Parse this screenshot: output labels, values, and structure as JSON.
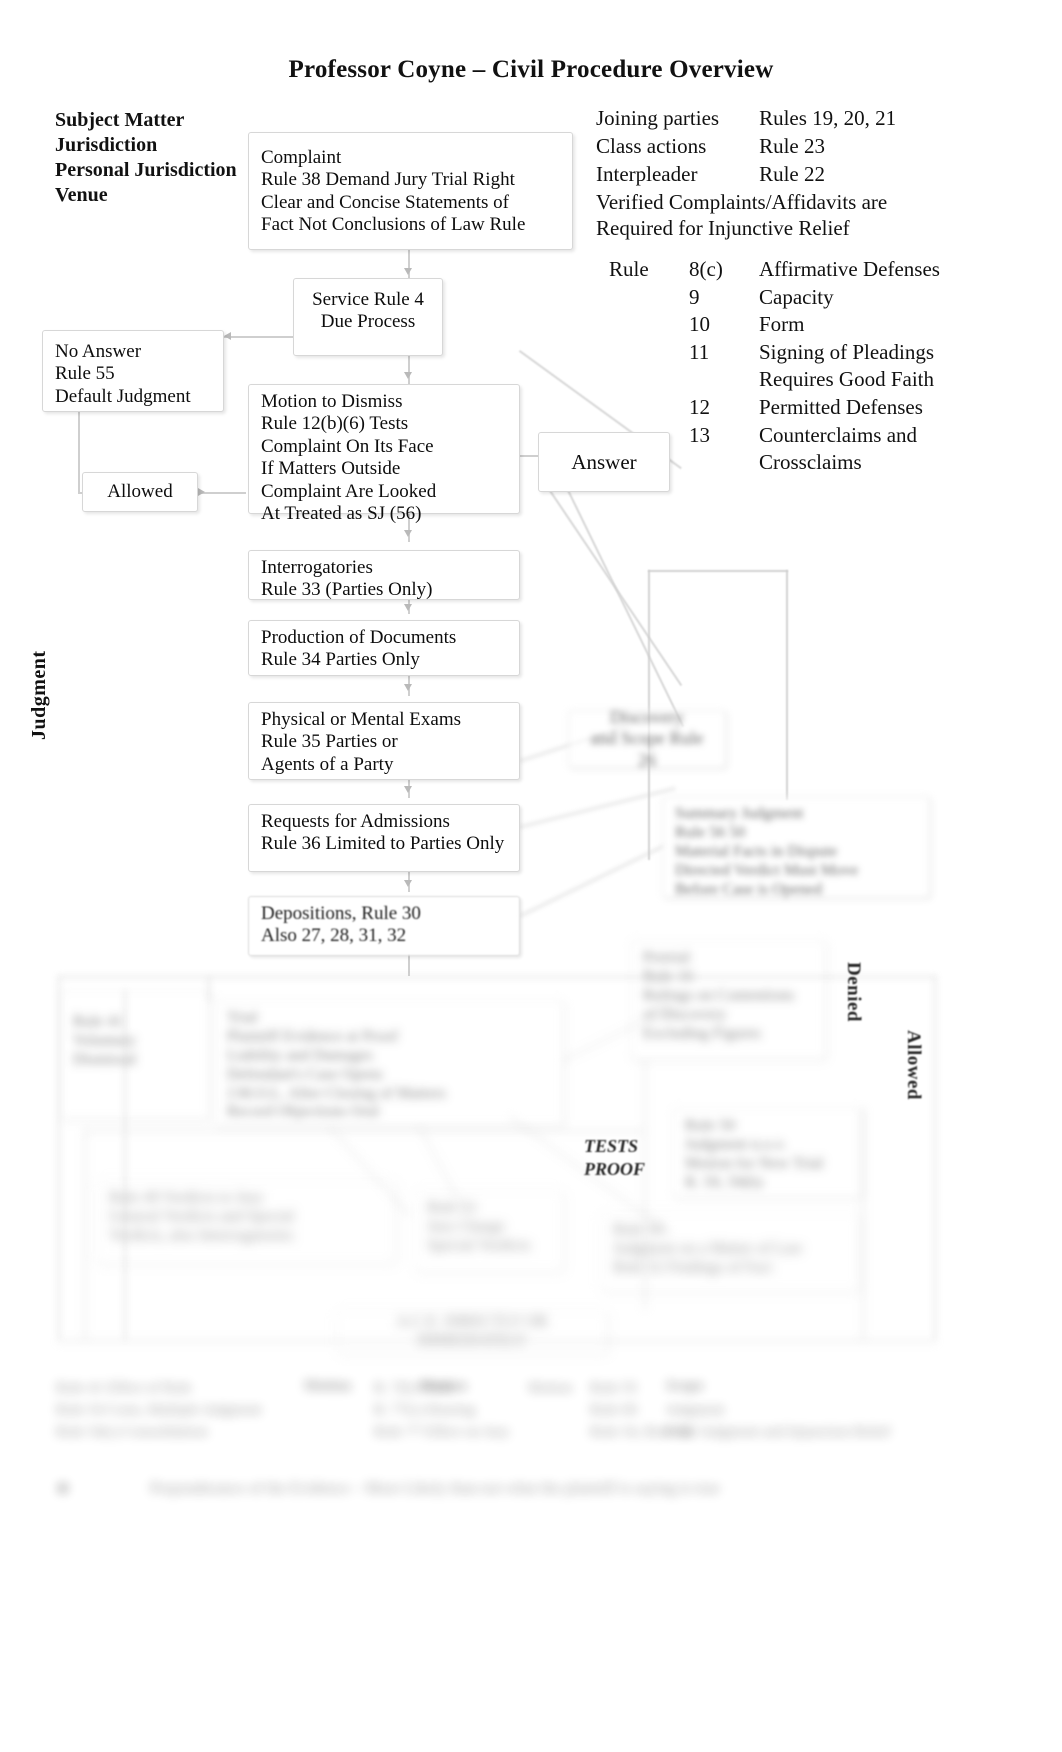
{
  "title": "Professor Coyne – Civil Procedure Overview",
  "left_header": "Subject Matter\nJurisdiction\nPersonal Jurisdiction\nVenue",
  "top_right_pairs": [
    {
      "left": "Joining parties",
      "right": "Rules 19, 20, 21"
    },
    {
      "left": "Class actions",
      "right": "Rule 23"
    },
    {
      "left": "Interpleader",
      "right": "Rule 22"
    }
  ],
  "top_right_note": "Verified Complaints/Affidavits are\nRequired for Injunctive Relief",
  "rules_label": "Rule",
  "rules": [
    {
      "num": "8(c)",
      "desc": "Affirmative Defenses"
    },
    {
      "num": "9",
      "desc": "Capacity"
    },
    {
      "num": "10",
      "desc": "Form"
    },
    {
      "num": "11",
      "desc": "Signing of Pleadings"
    },
    {
      "num": "",
      "desc": "Requires Good Faith"
    },
    {
      "num": "12",
      "desc": "Permitted Defenses"
    },
    {
      "num": "13",
      "desc": "Counterclaims and"
    },
    {
      "num": "",
      "desc": "Crossclaims"
    }
  ],
  "nodes": {
    "complaint": "Complaint\nRule 38 Demand Jury Trial Right\nClear and Concise Statements of\nFact Not Conclusions of Law Rule",
    "service": "Service Rule 4\nDue Process",
    "no_answer": "No Answer\nRule 55\nDefault Judgment",
    "allowed_box": "Allowed",
    "motion_to_dismiss": "Motion to Dismiss\nRule 12(b)(6) Tests\nComplaint On Its Face\nIf Matters Outside\nComplaint Are Looked\nAt Treated as SJ (56)",
    "answer": "Answer",
    "interrogatories": "Interrogatories\nRule 33 (Parties Only)",
    "production": "Production of Documents\nRule 34 Parties Only",
    "exams": "Physical or Mental Exams\nRule 35 Parties or\nAgents of a Party",
    "admissions": "Requests for Admissions\nRule 36 Limited to Parties Only",
    "depositions": "Depositions, Rule 30\nAlso 27, 28, 31, 32",
    "discovery": "Discovery\nand Scope Rule 26",
    "summary_judgment": "Summary Judgment\nRule 56   50\nMaterial Facts in Dispute\nDirected Verdict Must Move\nBefore Case is Opened",
    "denied_chain": "Pretrial\nRule 16\nRulings on Contentions\nof Discovery\nExcluding Figures",
    "jnov": "Rule 50\nJudgment n.o.v.\nMotion for New Trial\nR. 59, 59(b)",
    "trial": "Trial\nPlaintiff Evidence at Proof\nLiability and Damages\nDefendant's Case Opens\nJ.M.O.L. After Closing of Matters\nRecord Objections Oral",
    "rule49": "Rule 49   Verdicts to Jury\nGeneral Verdicts and Special\nVerdicts, also Interrogatories",
    "rule51": "Rule 51\nJury Charge\nSpecial Verdicts",
    "rule58": "Rule 58\nJudgment on a Matter of Law\nRule 52 Findings of Fact",
    "appeal": "Rule 59   Appeal\nRule 60   Relief from Judgment\nRule 62   Stay",
    "final": "A.C.E. DIRECTLY OR IMMEDIATELY",
    "tests_proof": "TESTS\nPROOF",
    "left_small": "Rule 41\nVoluntary\nDismissal",
    "right_small": "Summary Judgment\nRule 56   50\nMaterial Facts in Dispute\nDirected Verdict Must Move\nBefore Case is Opened"
  },
  "vertical_labels": {
    "judgment": "Judgment",
    "denied": "Denied",
    "allowed": "Allowed"
  },
  "footer": {
    "col1": "Rule 41 Effect of Rule\nRule 54 Costs, Multiple Judgment\nRule 54(c) Consolidation",
    "col2_label": "Motion",
    "col2": "R. 7(b)   Form\nR. 77(c)   Hearing\nRule 77   Effect on Jury",
    "col3_label": "Motion",
    "col3": "Rule 55\nRule 60\nRule 54, Rule 68",
    "col4_label": "Scope",
    "col4": "Judgment\nFinal Judgment and Injunction Relief",
    "note": "Preponderance of the Evidence  –  More Likely than not what the plaintiff is saying is true"
  }
}
